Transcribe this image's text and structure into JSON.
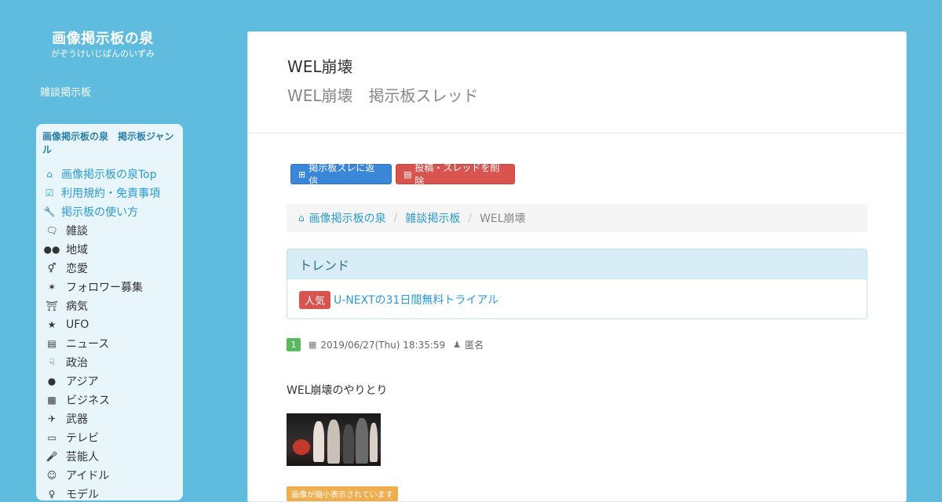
{
  "site": {
    "title": "画像掲示板の泉",
    "subtitle": "がぞうけいじばんのいずみ",
    "board_link": "雑談掲示板"
  },
  "sidebar": {
    "heading": "画像掲示板の泉　掲示板ジャンル",
    "links": [
      {
        "icon": "home-icon",
        "label": "画像掲示板の泉Top"
      },
      {
        "icon": "check-square-icon",
        "label": "利用規約・免責事項"
      },
      {
        "icon": "wrench-icon",
        "label": "掲示板の使い方"
      }
    ],
    "genres": [
      {
        "icon": "comments-icon",
        "label": "雑談"
      },
      {
        "icon": "users-icon",
        "label": "地域"
      },
      {
        "icon": "venus-mars-icon",
        "label": "恋愛"
      },
      {
        "icon": "twitter-icon",
        "label": "フォロワー募集"
      },
      {
        "icon": "ambulance-icon",
        "label": "病気"
      },
      {
        "icon": "star-icon",
        "label": "UFO"
      },
      {
        "icon": "newspaper-icon",
        "label": "ニュース"
      },
      {
        "icon": "thumbs-down-icon",
        "label": "政治"
      },
      {
        "icon": "globe-icon",
        "label": "アジア"
      },
      {
        "icon": "money-icon",
        "label": "ビジネス"
      },
      {
        "icon": "fighter-jet-icon",
        "label": "武器"
      },
      {
        "icon": "desktop-icon",
        "label": "テレビ"
      },
      {
        "icon": "microphone-icon",
        "label": "芸能人"
      },
      {
        "icon": "smile-icon",
        "label": "アイドル"
      },
      {
        "icon": "female-icon",
        "label": "モデル"
      }
    ]
  },
  "thread": {
    "title": "WEL崩壊",
    "subtitle": "WEL崩壊　掲示板スレッド"
  },
  "buttons": {
    "reply": "掲示板スレに返信",
    "delete": "投稿・スレッドを削除"
  },
  "breadcrumb": {
    "home": "画像掲示板の泉",
    "board": "雑談掲示板",
    "current": "WEL崩壊"
  },
  "trend": {
    "heading": "トレンド",
    "badge": "人気",
    "link": "U-NEXTの31日間無料トライアル"
  },
  "post": {
    "number": "1",
    "datetime": "2019/06/27(Thu) 18:35:59",
    "author": "匿名",
    "body": "WEL崩壊のやりとり",
    "resize_note": "画像が縮小表示されています"
  },
  "colors": {
    "background": "#5fbcdf",
    "link": "#2a9ad4",
    "primary_button": "#3a86d8",
    "danger_button": "#d9534f",
    "post_badge": "#5cb85c",
    "warning_note": "#f0ad4e"
  }
}
